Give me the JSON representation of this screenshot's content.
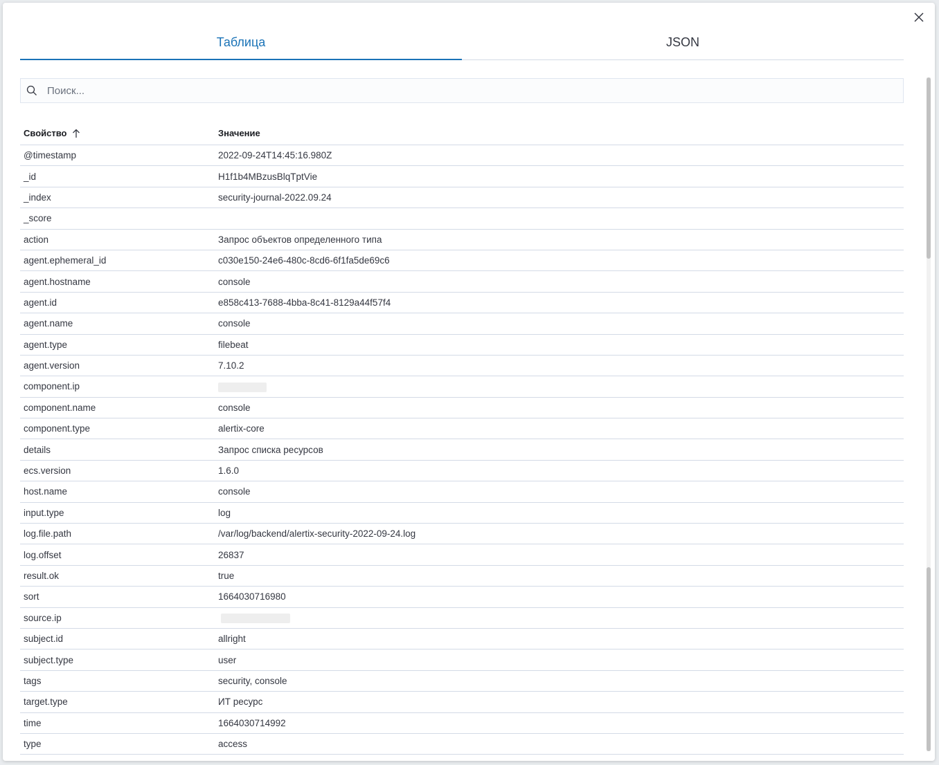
{
  "tabs": [
    {
      "label": "Таблица",
      "active": true
    },
    {
      "label": "JSON",
      "active": false
    }
  ],
  "search": {
    "placeholder": "Поиск..."
  },
  "table": {
    "headers": {
      "property": "Свойство",
      "value": "Значение"
    },
    "sort": "ascending",
    "rows": [
      {
        "property": "@timestamp",
        "value": "2022-09-24T14:45:16.980Z"
      },
      {
        "property": "_id",
        "value": "H1f1b4MBzusBlqTptVie"
      },
      {
        "property": "_index",
        "value": "security-journal-2022.09.24"
      },
      {
        "property": "_score",
        "value": ""
      },
      {
        "property": "action",
        "value": "Запрос объектов определенного типа"
      },
      {
        "property": "agent.ephemeral_id",
        "value": "c030e150-24e6-480c-8cd6-6f1fa5de69c6"
      },
      {
        "property": "agent.hostname",
        "value": "console"
      },
      {
        "property": "agent.id",
        "value": "e858c413-7688-4bba-8c41-8129a44f57f4"
      },
      {
        "property": "agent.name",
        "value": "console"
      },
      {
        "property": "agent.type",
        "value": "filebeat"
      },
      {
        "property": "agent.version",
        "value": "7.10.2"
      },
      {
        "property": "component.ip",
        "value": "",
        "redacted": true
      },
      {
        "property": "component.name",
        "value": "console"
      },
      {
        "property": "component.type",
        "value": "alertix-core"
      },
      {
        "property": "details",
        "value": "Запрос списка ресурсов"
      },
      {
        "property": "ecs.version",
        "value": "1.6.0"
      },
      {
        "property": "host.name",
        "value": "console"
      },
      {
        "property": "input.type",
        "value": "log"
      },
      {
        "property": "log.file.path",
        "value": "/var/log/backend/alertix-security-2022-09-24.log"
      },
      {
        "property": "log.offset",
        "value": "26837"
      },
      {
        "property": "result.ok",
        "value": "true"
      },
      {
        "property": "sort",
        "value": "1664030716980"
      },
      {
        "property": "source.ip",
        "value": "",
        "redacted": true
      },
      {
        "property": "subject.id",
        "value": "allright"
      },
      {
        "property": "subject.type",
        "value": "user"
      },
      {
        "property": "tags",
        "value": "security, console"
      },
      {
        "property": "target.type",
        "value": "ИТ ресурс"
      },
      {
        "property": "time",
        "value": "1664030714992"
      },
      {
        "property": "type",
        "value": "access"
      }
    ]
  },
  "colors": {
    "accent": "#1a73b7",
    "border": "#d3dae6",
    "text": "#343741"
  },
  "icons": {
    "close": "close-icon",
    "search": "search-icon",
    "sort": "arrow-up-icon"
  }
}
